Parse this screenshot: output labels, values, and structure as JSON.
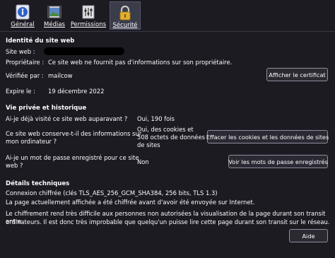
{
  "tabs": [
    {
      "label": "Général",
      "icon": "info-icon"
    },
    {
      "label": "Médias",
      "icon": "media-icon"
    },
    {
      "label": "Permissions",
      "icon": "permissions-icon"
    },
    {
      "label": "Sécurité",
      "icon": "lock-icon",
      "selected": true
    }
  ],
  "identity": {
    "title": "Identité du site web",
    "site_label": "Site web :",
    "owner_label": "Propriétaire :",
    "owner_value": "Ce site web ne fournit pas d'informations sur son propriétaire.",
    "verified_label": "Vérifiée par :",
    "verified_value": "mailcow",
    "expires_label": "Expire le :",
    "expires_value": "19 décembre 2022",
    "show_cert_button": "Afficher le certificat"
  },
  "privacy": {
    "title": "Vie privée et historique",
    "visited_q": "Ai-je déjà visité ce site web auparavant ?",
    "visited_a": "Oui, 190 fois",
    "cookies_q1": "Ce site web conserve-t-il des informations sur",
    "cookies_q2": "mon ordinateur ?",
    "cookies_a1": "Oui, des cookies et",
    "cookies_a2": "508 octets de données",
    "cookies_a3": "de sites",
    "clear_button": "Effacer les cookies et les données de sites",
    "password_q1": "Ai-je un mot de passe enregistré pour ce site",
    "password_q2": "web ?",
    "password_a": "Non",
    "passwords_button": "Voir les mots de passe enregistrés"
  },
  "technical": {
    "title": "Détails techniques",
    "line1": "Connexion chiffrée (clés TLS_AES_256_GCM_SHA384, 256 bits, TLS 1.3)",
    "line2": "La page actuellement affichée a été chiffrée avant d'avoir été envoyée sur Internet.",
    "line3": "Le chiffrement rend très difficile aux personnes non autorisées la visualisation de la page durant son transit entre",
    "line4": "ordinateurs. Il est donc très improbable que quelqu'un puisse lire cette page durant son transit sur le réseau."
  },
  "help_button": "Aide",
  "colors": {
    "background": "#1c1b22",
    "text": "#fbfbfe",
    "selected_tab": "#3b3c4a",
    "button_bg": "#2b2a33",
    "button_border": "#8f8f9d"
  }
}
